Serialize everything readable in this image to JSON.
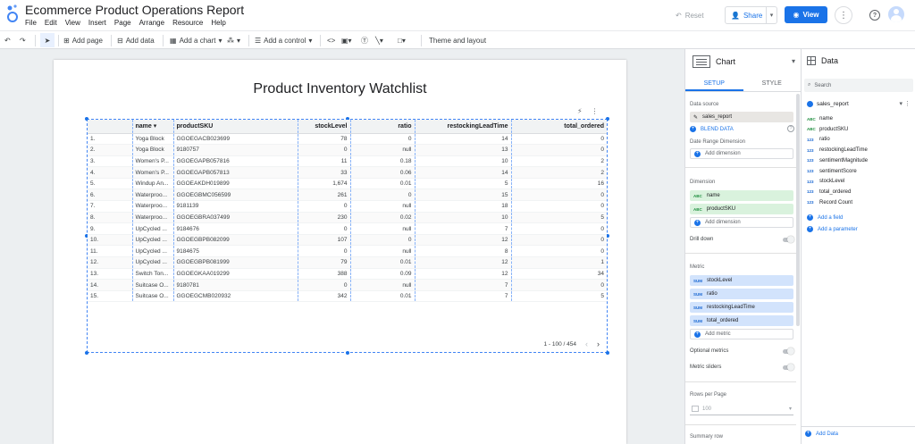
{
  "app": {
    "doc_title": "Ecommerce Product Operations Report",
    "menu": [
      "File",
      "Edit",
      "View",
      "Insert",
      "Page",
      "Arrange",
      "Resource",
      "Help"
    ],
    "reset_label": "Reset",
    "share_label": "Share",
    "view_label": "View"
  },
  "toolbar": {
    "add_page": "Add page",
    "add_data": "Add data",
    "add_chart": "Add a chart",
    "add_control": "Add a control",
    "theme": "Theme and layout"
  },
  "report": {
    "title": "Product Inventory Watchlist",
    "columns": [
      "",
      "name",
      "productSKU",
      "stockLevel",
      "ratio",
      "restockingLeadTime",
      "total_ordered"
    ],
    "sort_indicator": "▾",
    "rows": [
      [
        "1.",
        "Yoga Block",
        "GGOEGACB023699",
        "78",
        "0",
        "14",
        "0"
      ],
      [
        "2.",
        "Yoga Block",
        "9180757",
        "0",
        "null",
        "13",
        "0"
      ],
      [
        "3.",
        "Women's P...",
        "GGOEGAPB057816",
        "11",
        "0.18",
        "10",
        "2"
      ],
      [
        "4.",
        "Women's P...",
        "GGOEGAPB057813",
        "33",
        "0.06",
        "14",
        "2"
      ],
      [
        "5.",
        "Windup An...",
        "GGOEAKDH019899",
        "1,674",
        "0.01",
        "5",
        "16"
      ],
      [
        "6.",
        "Waterproo...",
        "GGOEGBMC056599",
        "261",
        "0",
        "15",
        "0"
      ],
      [
        "7.",
        "Waterproo...",
        "9181139",
        "0",
        "null",
        "18",
        "0"
      ],
      [
        "8.",
        "Waterproo...",
        "GGOEGBRA037499",
        "230",
        "0.02",
        "10",
        "5"
      ],
      [
        "9.",
        "UpCycled ...",
        "9184676",
        "0",
        "null",
        "7",
        "0"
      ],
      [
        "10.",
        "UpCycled ...",
        "GGOEGBPB082099",
        "107",
        "0",
        "12",
        "0"
      ],
      [
        "11.",
        "UpCycled ...",
        "9184675",
        "0",
        "null",
        "8",
        "0"
      ],
      [
        "12.",
        "UpCycled ...",
        "GGOEGBPB081999",
        "79",
        "0.01",
        "12",
        "1"
      ],
      [
        "13.",
        "Switch Ton...",
        "GGOEGKAA019299",
        "388",
        "0.09",
        "12",
        "34"
      ],
      [
        "14.",
        "Suitcase O...",
        "9180781",
        "0",
        "null",
        "7",
        "0"
      ],
      [
        "15.",
        "Suitcase O...",
        "GGOEGCMB020932",
        "342",
        "0.01",
        "7",
        "5"
      ]
    ],
    "pagination": "1 - 100 / 454"
  },
  "chart_panel": {
    "title": "Chart",
    "tabs": [
      "SETUP",
      "STYLE"
    ],
    "data_source_label": "Data source",
    "data_source": "sales_report",
    "blend_data": "BLEND DATA",
    "date_range_label": "Date Range Dimension",
    "add_dimension": "Add dimension",
    "dimension_label": "Dimension",
    "dimensions": [
      "name",
      "productSKU"
    ],
    "drill_down": "Drill down",
    "metric_label": "Metric",
    "metrics": [
      "stockLevel",
      "ratio",
      "restockingLeadTime",
      "total_ordered"
    ],
    "add_metric": "Add metric",
    "optional_metrics": "Optional metrics",
    "metric_sliders": "Metric sliders",
    "rows_per_page_label": "Rows per Page",
    "rows_per_page": "100",
    "summary_row": "Summary row",
    "dim_tag": "ABC",
    "met_tag": "SUM"
  },
  "data_panel": {
    "title": "Data",
    "search_placeholder": "Search",
    "source": "sales_report",
    "fields": [
      {
        "type": "ABC",
        "name": "name"
      },
      {
        "type": "ABC",
        "name": "productSKU"
      },
      {
        "type": "123",
        "name": "ratio"
      },
      {
        "type": "123",
        "name": "restockingLeadTime"
      },
      {
        "type": "123",
        "name": "sentimentMagnitude"
      },
      {
        "type": "123",
        "name": "sentimentScore"
      },
      {
        "type": "123",
        "name": "stockLevel"
      },
      {
        "type": "123",
        "name": "total_ordered"
      },
      {
        "type": "123",
        "name": "Record Count"
      }
    ],
    "add_field": "Add a field",
    "add_parameter": "Add a parameter",
    "add_data": "Add Data"
  },
  "colors": {
    "accent": "#1a73e8",
    "dimension_chip": "#d9f2dd",
    "metric_chip": "#d2e3fc"
  }
}
